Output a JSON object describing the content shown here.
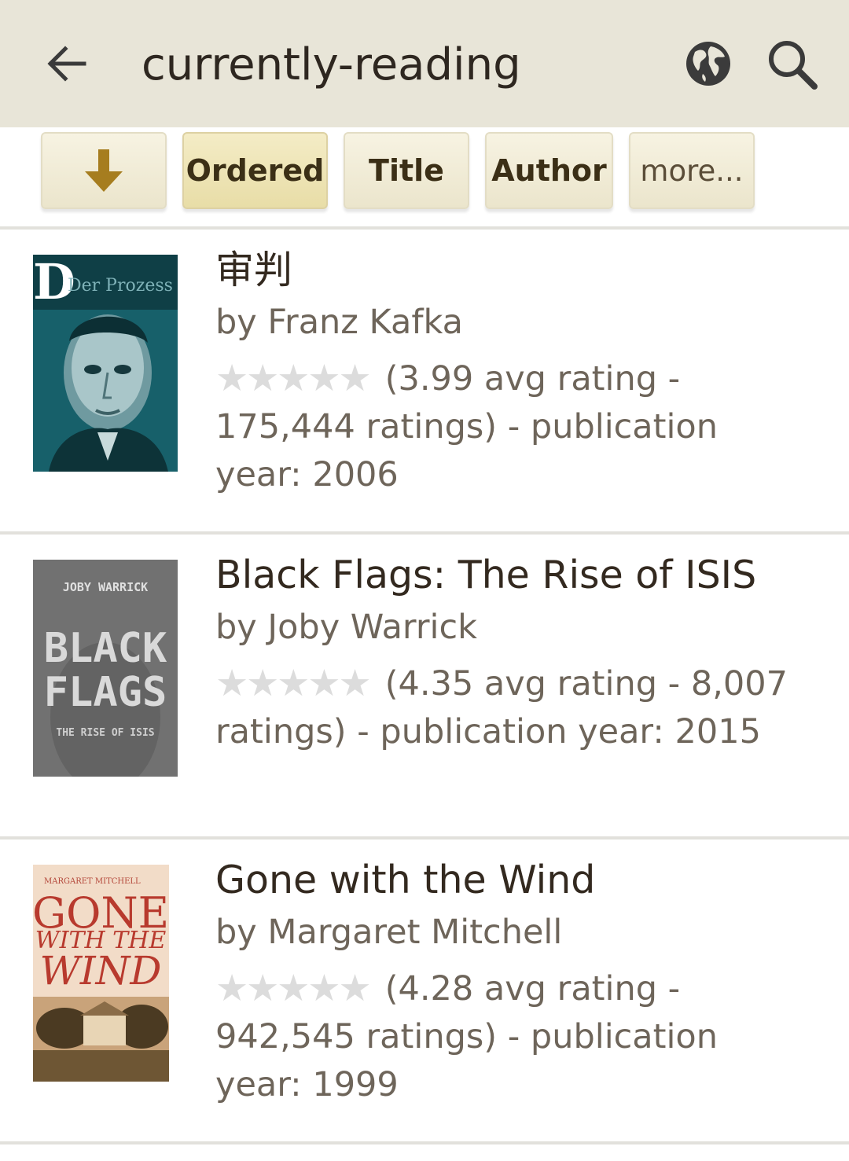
{
  "header": {
    "title": "currently-reading"
  },
  "sort_bar": {
    "sort_direction_icon": "arrow-down-icon",
    "buttons": [
      {
        "label": "Ordered",
        "active": true
      },
      {
        "label": "Title",
        "active": false
      },
      {
        "label": "Author",
        "active": false
      },
      {
        "label": "more...",
        "active": false
      }
    ]
  },
  "books": [
    {
      "title": "审判",
      "author": "by Franz Kafka",
      "stars": "★★★★★",
      "stats": "(3.99 avg rating - 175,444 ratings) - publication year: 2006",
      "cover_text": [
        "D",
        "Der Prozess"
      ]
    },
    {
      "title": "Black Flags: The Rise of ISIS",
      "author": "by Joby Warrick",
      "stars": "★★★★★",
      "stats": "(4.35 avg rating - 8,007 ratings) - publication year: 2015",
      "cover_text": [
        "JOBY WARRICK",
        "BLACK",
        "FLAGS",
        "THE RISE OF ISIS"
      ]
    },
    {
      "title": "Gone with the Wind",
      "author": "by Margaret Mitchell",
      "stars": "★★★★★",
      "stats": "(4.28 avg rating - 942,545 ratings) - publication year: 1999",
      "cover_text": [
        "MARGARET MITCHELL",
        "GONE",
        "WITH THE",
        "WIND"
      ]
    }
  ],
  "colors": {
    "header_bg": "#e8e5d8",
    "button_bg": "#f1ecd6",
    "button_active_bg": "#ebe2b6",
    "arrow": "#a67d1f",
    "title_text": "#33291f",
    "secondary_text": "#6e655a",
    "star_empty": "#dcdcdc"
  }
}
